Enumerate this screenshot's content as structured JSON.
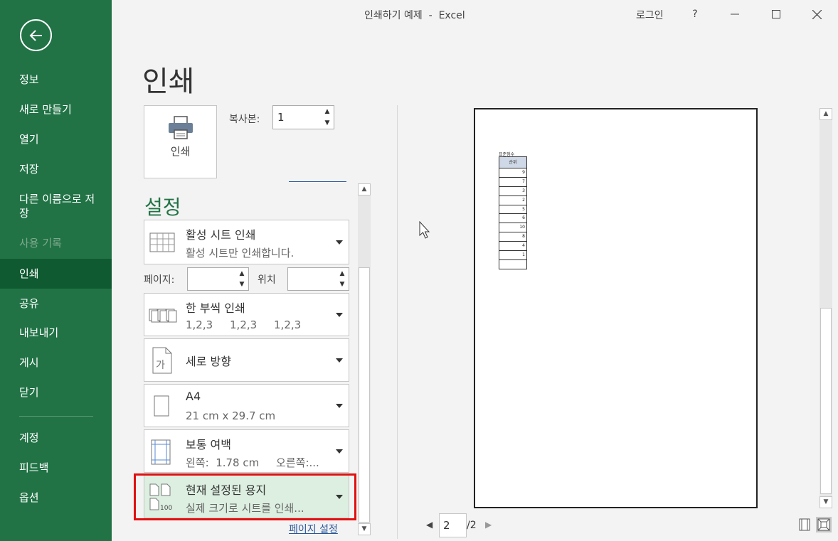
{
  "window": {
    "title": "인쇄하기 예제  -  Excel",
    "login": "로그인",
    "help": "?"
  },
  "sidebar": {
    "items": [
      {
        "label": "정보"
      },
      {
        "label": "새로 만들기"
      },
      {
        "label": "열기"
      },
      {
        "label": "저장"
      },
      {
        "label": "다른 이름으로 저\n장"
      },
      {
        "label": "사용 기록"
      },
      {
        "label": "인쇄"
      },
      {
        "label": "공유"
      },
      {
        "label": "내보내기"
      },
      {
        "label": "게시"
      },
      {
        "label": "닫기"
      },
      {
        "label": "계정"
      },
      {
        "label": "피드백"
      },
      {
        "label": "옵션"
      }
    ],
    "active": "인쇄",
    "disabled": "사용 기록"
  },
  "print": {
    "heading": "인쇄",
    "button_label": "인쇄",
    "copies_label": "복사본:",
    "copies_value": "1"
  },
  "settings": {
    "heading": "설정",
    "pages_label": "페이지:",
    "to_label": "위치",
    "dropdowns": [
      {
        "line1": "활성 시트 인쇄",
        "line2": "활성 시트만 인쇄합니다."
      },
      {
        "line1": "한 부씩 인쇄",
        "line2": "1,2,3     1,2,3     1,2,3"
      },
      {
        "line1": "세로 방향",
        "line2": ""
      },
      {
        "line1": "A4",
        "line2": "21 cm x 29.7 cm"
      },
      {
        "line1": "보통 여백",
        "line2": "왼쪽:  1.78 cm     오른쪽:..."
      },
      {
        "line1": "현재 설정된 용지",
        "line2": "실제 크기로 시트를 인쇄..."
      }
    ],
    "page_setup_link": "페이지 설정",
    "orientation_icon_text": "가",
    "scaling_icon_text": "100"
  },
  "preview": {
    "sheet_title": "표준점수",
    "table_header": "순위",
    "table_values": [
      "9",
      "7",
      "3",
      "2",
      "5",
      "6",
      "10",
      "8",
      "4",
      "1",
      ""
    ],
    "current_page": "2",
    "total_pages": "/2"
  },
  "colors": {
    "accent": "#217346",
    "highlight_border": "#e01010",
    "selected_fill": "#dcefe0"
  }
}
